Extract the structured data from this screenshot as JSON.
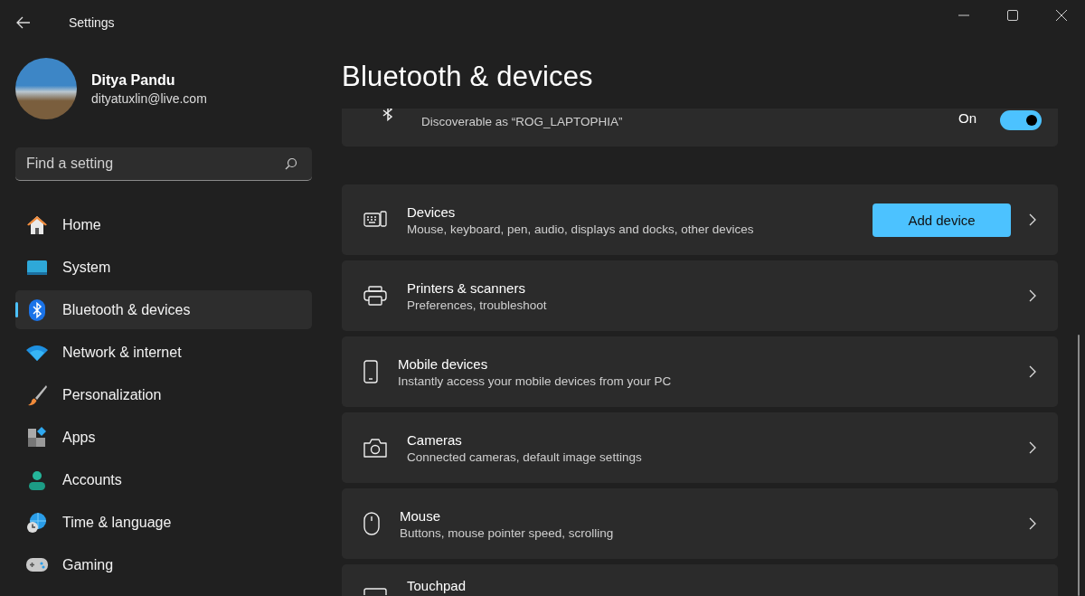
{
  "window": {
    "title": "Settings"
  },
  "profile": {
    "name": "Ditya Pandu",
    "email": "dityatuxlin@live.com"
  },
  "search": {
    "placeholder": "Find a setting"
  },
  "sidebar": {
    "items": [
      {
        "label": "Home",
        "selected": false
      },
      {
        "label": "System",
        "selected": false
      },
      {
        "label": "Bluetooth & devices",
        "selected": true
      },
      {
        "label": "Network & internet",
        "selected": false
      },
      {
        "label": "Personalization",
        "selected": false
      },
      {
        "label": "Apps",
        "selected": false
      },
      {
        "label": "Accounts",
        "selected": false
      },
      {
        "label": "Time & language",
        "selected": false
      },
      {
        "label": "Gaming",
        "selected": false
      }
    ]
  },
  "page": {
    "title": "Bluetooth & devices"
  },
  "cards": [
    {
      "kind": "toggle",
      "subtitle": "Discoverable as “ROG_LAPTOPHIA”",
      "state_label": "On",
      "on": true
    },
    {
      "kind": "link",
      "title": "Devices",
      "subtitle": "Mouse, keyboard, pen, audio, displays and docks, other devices",
      "button": "Add device"
    },
    {
      "kind": "link",
      "title": "Printers & scanners",
      "subtitle": "Preferences, troubleshoot"
    },
    {
      "kind": "link",
      "title": "Mobile devices",
      "subtitle": "Instantly access your mobile devices from your PC"
    },
    {
      "kind": "link",
      "title": "Cameras",
      "subtitle": "Connected cameras, default image settings"
    },
    {
      "kind": "link",
      "title": "Mouse",
      "subtitle": "Buttons, mouse pointer speed, scrolling"
    },
    {
      "kind": "partial",
      "title": "Touchpad"
    }
  ]
}
